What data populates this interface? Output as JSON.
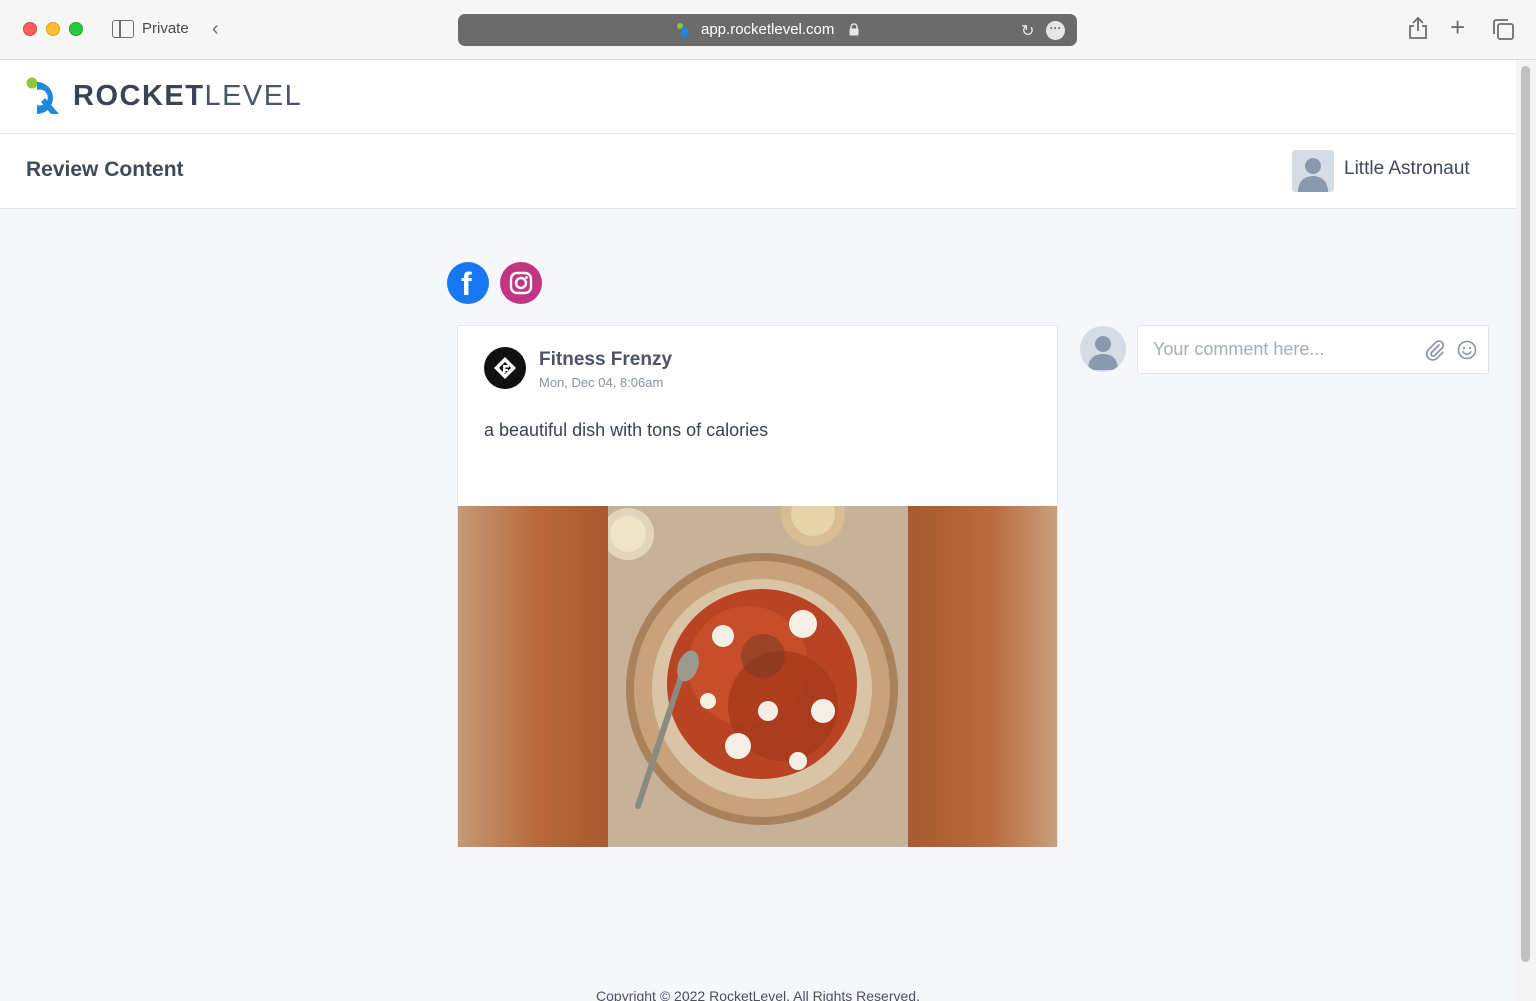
{
  "browser": {
    "private_label": "Private",
    "url": "app.rocketlevel.com",
    "icons": [
      "sidebar-icon",
      "back-icon",
      "lock-icon",
      "reload-icon",
      "more-icon",
      "share-icon",
      "plus-icon",
      "tabs-icon"
    ]
  },
  "app": {
    "logo_bold": "ROCKET",
    "logo_light": "LEVEL",
    "page_title": "Review Content",
    "user_name": "Little Astronaut",
    "brand_colors": {
      "blue": "#1f88d9",
      "green": "#8dc63f",
      "facebook": "#1877f2",
      "instagram": "#c13584"
    }
  },
  "post": {
    "author": "Fitness Frenzy",
    "date": "Mon, Dec 04, 8:06am",
    "text": "a beautiful dish with tons of calories",
    "platforms": [
      "facebook",
      "instagram"
    ]
  },
  "comment": {
    "placeholder": "Your comment here..."
  },
  "footer": {
    "copyright": "Copyright © 2022 RocketLevel. All Rights Reserved."
  }
}
